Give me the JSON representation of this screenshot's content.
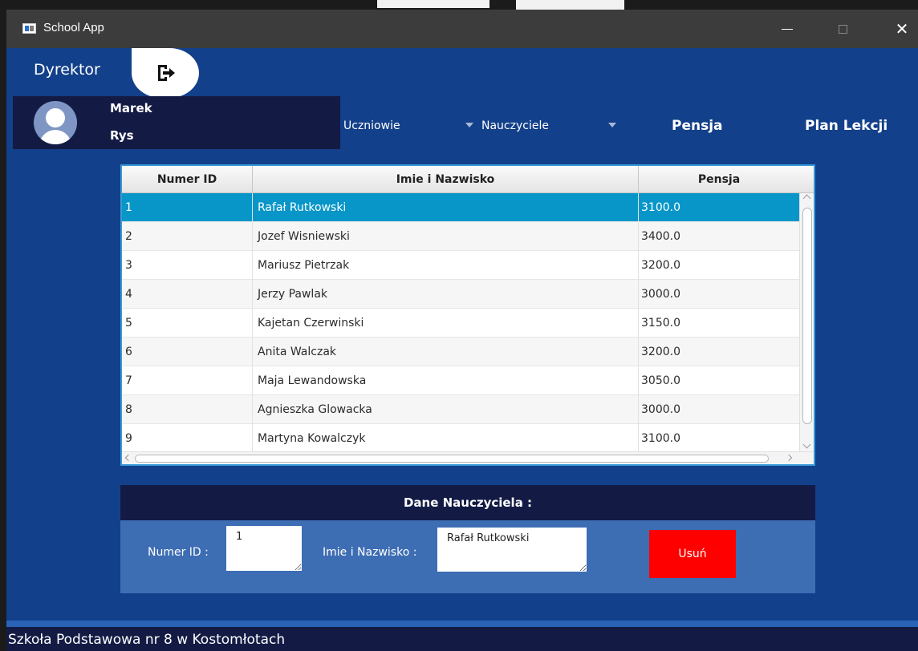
{
  "window": {
    "title": "School App"
  },
  "header": {
    "role": "Dyrektor",
    "user": {
      "first_name": "Marek",
      "last_name": "Rys"
    }
  },
  "menu": {
    "items": [
      "Uczniowie",
      "Nauczyciele",
      "Pensja",
      "Plan Lekcji"
    ]
  },
  "table": {
    "columns": [
      "Numer ID",
      "Imie i Nazwisko",
      "Pensja"
    ],
    "selected_index": 0,
    "rows": [
      {
        "id": "1",
        "name": "Rafał Rutkowski",
        "pay": "3100.0"
      },
      {
        "id": "2",
        "name": "Jozef Wisniewski",
        "pay": "3400.0"
      },
      {
        "id": "3",
        "name": "Mariusz Pietrzak",
        "pay": "3200.0"
      },
      {
        "id": "4",
        "name": "Jerzy Pawlak",
        "pay": "3000.0"
      },
      {
        "id": "5",
        "name": "Kajetan Czerwinski",
        "pay": "3150.0"
      },
      {
        "id": "6",
        "name": "Anita Walczak",
        "pay": "3200.0"
      },
      {
        "id": "7",
        "name": "Maja Lewandowska",
        "pay": "3050.0"
      },
      {
        "id": "8",
        "name": "Agnieszka Glowacka",
        "pay": "3000.0"
      },
      {
        "id": "9",
        "name": "Martyna Kowalczyk",
        "pay": "3100.0"
      }
    ]
  },
  "form": {
    "title": "Dane Nauczyciela :",
    "id_label": "Numer ID :",
    "id_value": "1",
    "name_label": "Imie i Nazwisko :",
    "name_value": "Rafał Rutkowski",
    "delete_label": "Usuń"
  },
  "footer": {
    "text": "Szkoła Podstawowa nr 8 w Kostomłotach"
  },
  "colors": {
    "background": "#13408a",
    "panel_dark": "#131b45",
    "form_body": "#3d6db3",
    "selection": "#0896c9",
    "delete": "#ff0000"
  }
}
